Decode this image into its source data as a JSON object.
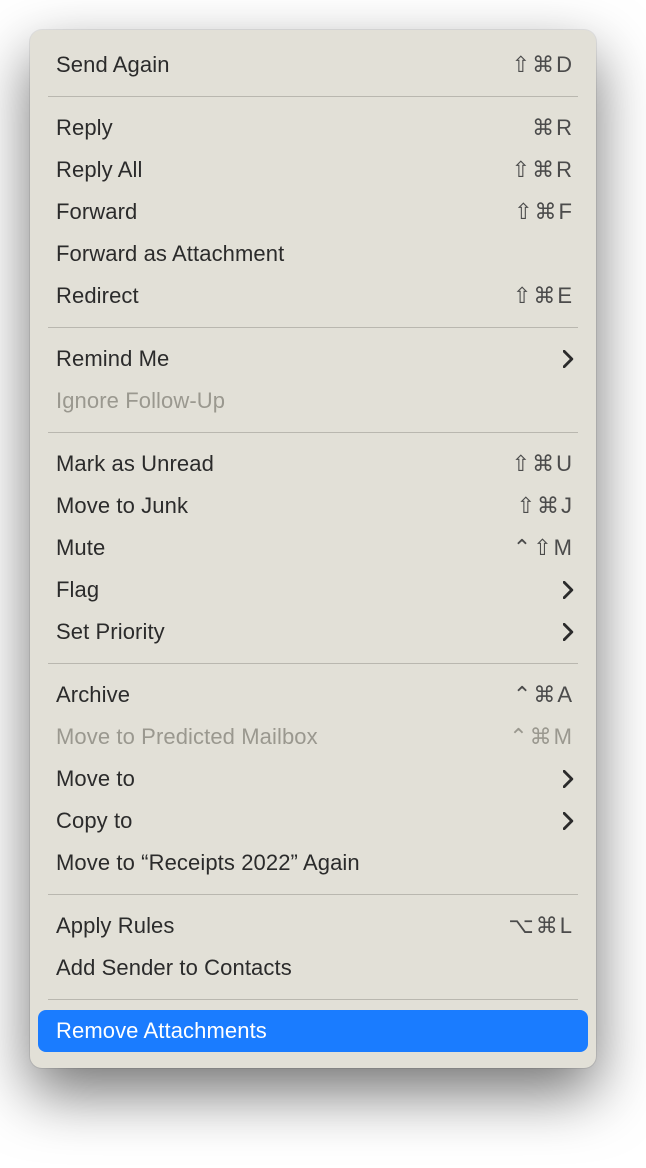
{
  "menu": {
    "groups": [
      [
        {
          "id": "send-again",
          "label": "Send Again",
          "shortcut": "⇧⌘D"
        }
      ],
      [
        {
          "id": "reply",
          "label": "Reply",
          "shortcut": "⌘R"
        },
        {
          "id": "reply-all",
          "label": "Reply All",
          "shortcut": "⇧⌘R"
        },
        {
          "id": "forward",
          "label": "Forward",
          "shortcut": "⇧⌘F"
        },
        {
          "id": "forward-as-attachment",
          "label": "Forward as Attachment"
        },
        {
          "id": "redirect",
          "label": "Redirect",
          "shortcut": "⇧⌘E"
        }
      ],
      [
        {
          "id": "remind-me",
          "label": "Remind Me",
          "submenu": true
        },
        {
          "id": "ignore-follow-up",
          "label": "Ignore Follow-Up",
          "disabled": true
        }
      ],
      [
        {
          "id": "mark-as-unread",
          "label": "Mark as Unread",
          "shortcut": "⇧⌘U"
        },
        {
          "id": "move-to-junk",
          "label": "Move to Junk",
          "shortcut": "⇧⌘J"
        },
        {
          "id": "mute",
          "label": "Mute",
          "shortcut": "⌃⇧M"
        },
        {
          "id": "flag",
          "label": "Flag",
          "submenu": true
        },
        {
          "id": "set-priority",
          "label": "Set Priority",
          "submenu": true
        }
      ],
      [
        {
          "id": "archive",
          "label": "Archive",
          "shortcut": "⌃⌘A"
        },
        {
          "id": "move-to-predicted-mailbox",
          "label": "Move to Predicted Mailbox",
          "shortcut": "⌃⌘M",
          "disabled": true
        },
        {
          "id": "move-to",
          "label": "Move to",
          "submenu": true
        },
        {
          "id": "copy-to",
          "label": "Copy to",
          "submenu": true
        },
        {
          "id": "move-to-again",
          "label": "Move to “Receipts 2022” Again"
        }
      ],
      [
        {
          "id": "apply-rules",
          "label": "Apply Rules",
          "shortcut": "⌥⌘L"
        },
        {
          "id": "add-sender-to-contacts",
          "label": "Add Sender to Contacts"
        }
      ],
      [
        {
          "id": "remove-attachments",
          "label": "Remove Attachments",
          "highlighted": true
        }
      ]
    ]
  }
}
